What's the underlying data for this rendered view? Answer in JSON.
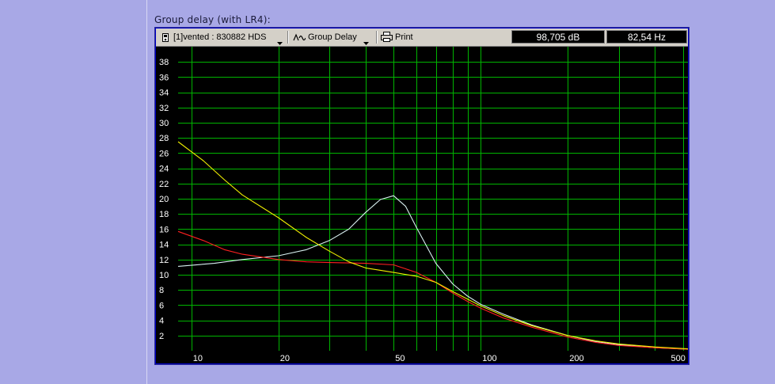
{
  "page": {
    "heading": "Group delay (with LR4):"
  },
  "toolbar": {
    "project_label": "[1]vented : 830882 HDS",
    "mode_label": "Group Delay",
    "print_label": "Print",
    "readout_db": "98,705 dB",
    "readout_hz": "82,54 Hz"
  },
  "colors": {
    "page_bg": "#a8a8e6",
    "plot_bg": "#000000",
    "grid": "#00b400",
    "series_cyan": "#d8f0f0",
    "series_red": "#ff2020",
    "series_yellow": "#f0f000"
  },
  "chart_data": {
    "type": "line",
    "title": "",
    "xlabel": "",
    "ylabel": "",
    "xscale": "log",
    "xlim": [
      9,
      520
    ],
    "ylim": [
      0,
      40
    ],
    "grid": true,
    "xticks": [
      10,
      20,
      50,
      100,
      200,
      500
    ],
    "xtick_labels": [
      "10",
      "20",
      "50",
      "100",
      "200",
      "500"
    ],
    "yticks": [
      2,
      4,
      6,
      8,
      10,
      12,
      14,
      16,
      18,
      20,
      22,
      24,
      26,
      28,
      30,
      32,
      34,
      36,
      38
    ],
    "ytick_labels": [
      "2",
      "4",
      "6",
      "8",
      "10",
      "12",
      "14",
      "16",
      "18",
      "20",
      "22",
      "24",
      "26",
      "28",
      "30",
      "32",
      "34",
      "36",
      "38"
    ],
    "series": [
      {
        "color": "#d8f0f0",
        "points": [
          [
            9,
            11.1
          ],
          [
            12,
            11.5
          ],
          [
            15,
            12.0
          ],
          [
            20,
            12.5
          ],
          [
            25,
            13.3
          ],
          [
            30,
            14.5
          ],
          [
            35,
            16.0
          ],
          [
            40,
            18.2
          ],
          [
            45,
            19.9
          ],
          [
            50,
            20.4
          ],
          [
            55,
            19.0
          ],
          [
            60,
            16.2
          ],
          [
            70,
            11.5
          ],
          [
            80,
            8.8
          ],
          [
            90,
            7.2
          ],
          [
            100,
            6.1
          ],
          [
            120,
            4.8
          ],
          [
            150,
            3.4
          ],
          [
            200,
            2.0
          ],
          [
            250,
            1.2
          ],
          [
            300,
            0.8
          ],
          [
            400,
            0.4
          ],
          [
            520,
            0.2
          ]
        ]
      },
      {
        "color": "#ff2020",
        "points": [
          [
            9,
            15.7
          ],
          [
            11,
            14.5
          ],
          [
            13,
            13.3
          ],
          [
            15,
            12.7
          ],
          [
            20,
            12.0
          ],
          [
            25,
            11.7
          ],
          [
            30,
            11.6
          ],
          [
            40,
            11.5
          ],
          [
            50,
            11.3
          ],
          [
            60,
            10.3
          ],
          [
            70,
            9.0
          ],
          [
            80,
            7.6
          ],
          [
            90,
            6.5
          ],
          [
            100,
            5.6
          ],
          [
            120,
            4.3
          ],
          [
            150,
            3.1
          ],
          [
            200,
            1.8
          ],
          [
            250,
            1.1
          ],
          [
            300,
            0.7
          ],
          [
            400,
            0.4
          ],
          [
            520,
            0.2
          ]
        ]
      },
      {
        "color": "#f0f000",
        "points": [
          [
            9,
            27.5
          ],
          [
            11,
            25.0
          ],
          [
            13,
            22.5
          ],
          [
            15,
            20.5
          ],
          [
            20,
            17.5
          ],
          [
            25,
            14.9
          ],
          [
            30,
            13.1
          ],
          [
            35,
            11.7
          ],
          [
            40,
            10.9
          ],
          [
            50,
            10.3
          ],
          [
            60,
            9.8
          ],
          [
            70,
            9.0
          ],
          [
            80,
            7.8
          ],
          [
            90,
            6.8
          ],
          [
            100,
            5.9
          ],
          [
            120,
            4.6
          ],
          [
            150,
            3.3
          ],
          [
            200,
            2.0
          ],
          [
            250,
            1.3
          ],
          [
            300,
            0.9
          ],
          [
            400,
            0.5
          ],
          [
            520,
            0.25
          ]
        ]
      }
    ]
  }
}
